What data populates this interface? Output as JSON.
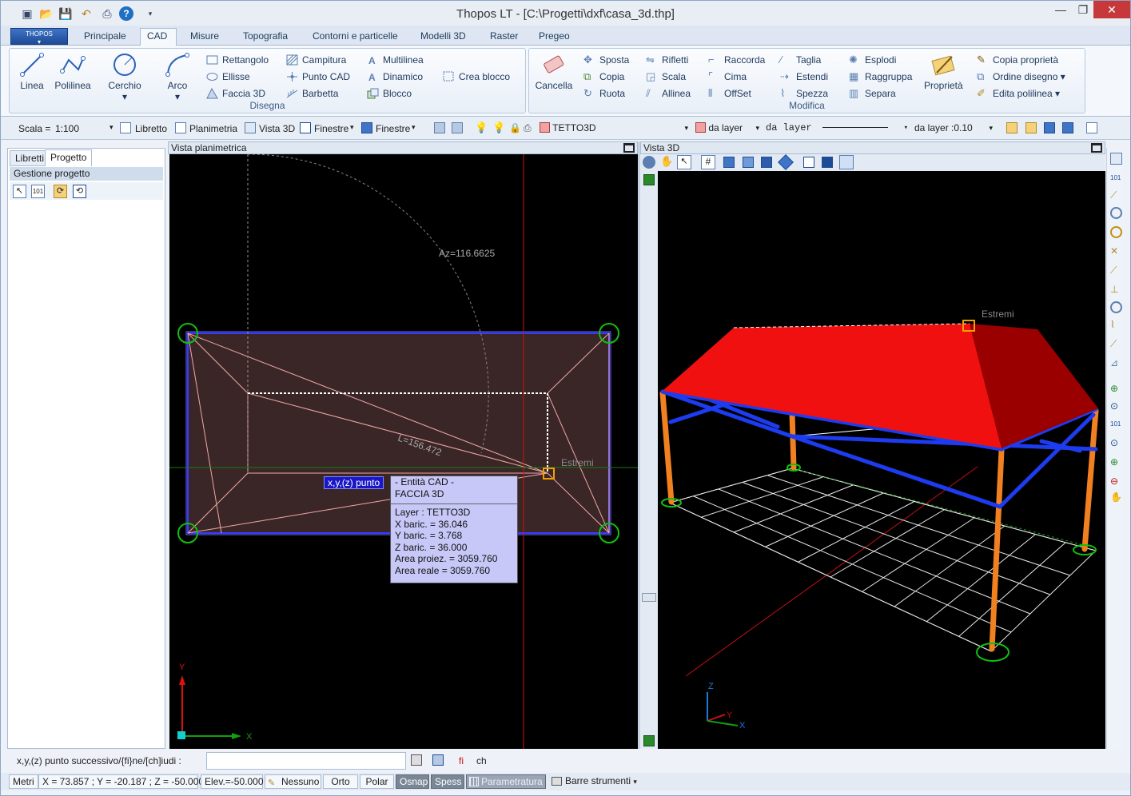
{
  "window": {
    "title": "Thopos LT - [C:\\Progetti\\dxf\\casa_3d.thp]",
    "quick_access_icons": [
      "new-icon",
      "open-icon",
      "save-icon",
      "undo-icon",
      "print-icon",
      "help-icon",
      "customize-icon"
    ]
  },
  "ribbon": {
    "logo_label": "THOPOS",
    "tabs": [
      "Principale",
      "CAD",
      "Misure",
      "Topografia",
      "Contorni e particelle",
      "Modelli 3D",
      "Raster",
      "Pregeo"
    ],
    "active_tab": "CAD",
    "disegna": {
      "label": "Disegna",
      "big": [
        "Linea",
        "Polilinea",
        "Cerchio",
        "Arco"
      ],
      "col1": [
        "Rettangolo",
        "Ellisse",
        "Faccia 3D"
      ],
      "col2": [
        "Campitura",
        "Punto CAD",
        "Barbetta"
      ],
      "col3": [
        "Multilinea",
        "Dinamico",
        "Blocco"
      ],
      "col4": [
        "Crea blocco"
      ]
    },
    "modifica": {
      "label": "Modifica",
      "cancella": "Cancella",
      "col1": [
        "Sposta",
        "Copia",
        "Ruota"
      ],
      "col2": [
        "Rifletti",
        "Scala",
        "Allinea"
      ],
      "col3": [
        "Raccorda",
        "Cima",
        "OffSet"
      ],
      "col4": [
        "Taglia",
        "Estendi",
        "Spezza"
      ],
      "col5": [
        "Esplodi",
        "Raggruppa",
        "Separa"
      ],
      "proprieta": "Proprietà",
      "col6": [
        "Copia proprietà",
        "Ordine disegno",
        "Edita polilinea"
      ]
    }
  },
  "property_toolbar": {
    "scale_label": "Scala =",
    "scale_value": "1:100",
    "libretto": "Libretto",
    "planimetria": "Planimetria",
    "vista3d": "Vista 3D",
    "finestre1": "Finestre",
    "finestre2": "Finestre",
    "layer": "TETTO3D",
    "color": "da layer",
    "linetype": "da layer",
    "lineweight": "da layer :0.10",
    "layer_color": "#f2a0a0"
  },
  "left_panel": {
    "tabs": [
      "Libretti",
      "Progetto"
    ],
    "active_tab": "Progetto",
    "header": "Gestione progetto"
  },
  "plan_view": {
    "title": "Vista planimetrica",
    "azimuth": "Az=116.6625",
    "length": "L=156.472",
    "snap_label": "Estremi",
    "prompt_tag": "x,y,(z) punto",
    "tooltip": {
      "line1": "- Entità CAD -",
      "line2": "FACCIA 3D",
      "layer": "Layer : TETTO3D",
      "xbar": "X baric. = 36.046",
      "ybar": "Y baric. = 3.768",
      "zbar": "Z baric. = 36.000",
      "area_proj": "Area proiez. = 3059.760",
      "area_real": "Area reale = 3059.760"
    },
    "axis_x": "X",
    "axis_y": "Y"
  },
  "view_3d": {
    "title": "Vista 3D",
    "snap_label": "Estremi",
    "axis_x": "X",
    "axis_y": "Y",
    "axis_z": "Z"
  },
  "command_line": {
    "prompt": "x,y,(z) punto successivo/{fi}ne/[ch]iudi :",
    "value": "",
    "opt1": "fi",
    "opt2": "ch"
  },
  "status_bar": {
    "units": "Metri",
    "coords": "X = 73.857 ; Y = -20.187 ; Z = -50.000",
    "elevation": "Elev.=-50.000",
    "snap_mode": "Nessuno",
    "orto": "Orto",
    "polar": "Polar",
    "osnap": "Osnap",
    "spess": "Spess",
    "param": "Parametratura",
    "toolbars": "Barre strumenti"
  }
}
